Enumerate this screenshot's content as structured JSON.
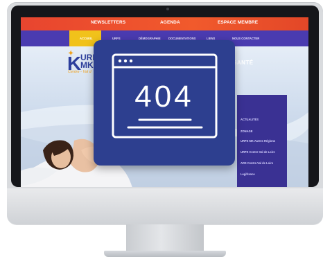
{
  "topbar": {
    "items": [
      "NEWSLETTERS",
      "AGENDA",
      "ESPACE MEMBRE"
    ]
  },
  "navbar": {
    "items": [
      "ACCUEIL",
      "URPS",
      "DÉMOGRAPHIE",
      "DOCUMENTATIONS",
      "LIENS",
      "NOUS CONTACTER"
    ],
    "active": "ACCUEIL"
  },
  "logo": {
    "mark": "K",
    "text_line1": "URP",
    "text_line2": "MK",
    "subtitle": "Centre - Val d"
  },
  "hero": {
    "partial_text": "SANTÉ"
  },
  "sidepanel": {
    "items": [
      "ACTUALITÉS",
      "ZONAGE",
      "URPS MK Autres Régions",
      "URPS Centre Val de Loire",
      "ARS Centre-Val de Loire",
      "Legifrance"
    ]
  },
  "error_graphic": {
    "code": "404",
    "icon": "browser-window-404-icon"
  },
  "colors": {
    "topbar": "#f15a2c",
    "navbar": "#4a3bb0",
    "nav_active": "#f1c21b",
    "overlay": "#2d3f8f",
    "sidepanel": "#3a3193"
  }
}
